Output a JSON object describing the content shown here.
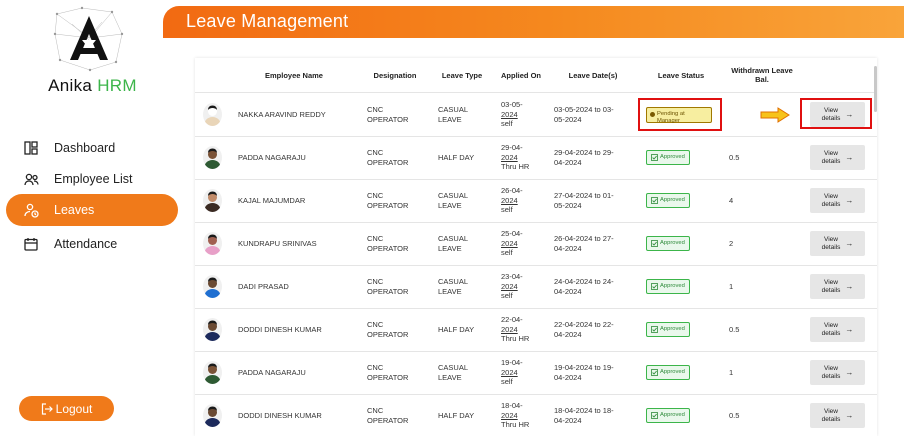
{
  "sidebar": {
    "brand_prefix": "Anika",
    "brand_highlight": "HRM",
    "items": [
      {
        "label": "Dashboard",
        "icon": "dashboard-icon",
        "active": false
      },
      {
        "label": "Employee List",
        "icon": "users-icon",
        "active": false
      },
      {
        "label": "Leaves",
        "icon": "leave-icon",
        "active": true
      },
      {
        "label": "Attendance",
        "icon": "calendar-icon",
        "active": false
      }
    ],
    "logout_label": "Logout"
  },
  "header": {
    "title": "Leave Management"
  },
  "table": {
    "columns": [
      "Employee Name",
      "Designation",
      "Leave Type",
      "Applied On",
      "Leave Date(s)",
      "Leave Status",
      "Withdrawn Leave Bal."
    ],
    "view_label_line1": "View",
    "view_label_line2": "details",
    "rows": [
      {
        "name": "NAKKA ARAVIND REDDY",
        "designation": [
          "CNC",
          "OPERATOR"
        ],
        "leave_type": [
          "CASUAL",
          "LEAVE"
        ],
        "applied_date": [
          "03-05-",
          "2024"
        ],
        "applied_by": "self",
        "leave_dates": [
          "03-05-2024 to 03-",
          "05-2024"
        ],
        "status": "Pending at Manager",
        "status_lines": [
          "Pending at",
          "Manager"
        ],
        "balance": ""
      },
      {
        "name": "PADDA NAGARAJU",
        "designation": [
          "CNC",
          "OPERATOR"
        ],
        "leave_type": [
          "HALF DAY",
          ""
        ],
        "applied_date": [
          "29-04-",
          "2024"
        ],
        "applied_by": "Thru HR",
        "leave_dates": [
          "29-04-2024 to 29-",
          "04-2024"
        ],
        "status": "Approved",
        "balance": "0.5"
      },
      {
        "name": "KAJAL MAJUMDAR",
        "designation": [
          "CNC",
          "OPERATOR"
        ],
        "leave_type": [
          "CASUAL",
          "LEAVE"
        ],
        "applied_date": [
          "26-04-",
          "2024"
        ],
        "applied_by": "self",
        "leave_dates": [
          "27-04-2024 to 01-",
          "05-2024"
        ],
        "status": "Approved",
        "balance": "4"
      },
      {
        "name": "KUNDRAPU SRINIVAS",
        "designation": [
          "CNC",
          "OPERATOR"
        ],
        "leave_type": [
          "CASUAL",
          "LEAVE"
        ],
        "applied_date": [
          "25-04-",
          "2024"
        ],
        "applied_by": "self",
        "leave_dates": [
          "26-04-2024 to 27-",
          "04-2024"
        ],
        "status": "Approved",
        "balance": "2"
      },
      {
        "name": "DADI PRASAD",
        "designation": [
          "CNC",
          "OPERATOR"
        ],
        "leave_type": [
          "CASUAL",
          "LEAVE"
        ],
        "applied_date": [
          "23-04-",
          "2024"
        ],
        "applied_by": "self",
        "leave_dates": [
          "24-04-2024 to 24-",
          "04-2024"
        ],
        "status": "Approved",
        "balance": "1"
      },
      {
        "name": "DODDI DINESH KUMAR",
        "designation": [
          "CNC",
          "OPERATOR"
        ],
        "leave_type": [
          "HALF DAY",
          ""
        ],
        "applied_date": [
          "22-04-",
          "2024"
        ],
        "applied_by": "Thru HR",
        "leave_dates": [
          "22-04-2024 to 22-",
          "04-2024"
        ],
        "status": "Approved",
        "balance": "0.5"
      },
      {
        "name": "PADDA NAGARAJU",
        "designation": [
          "CNC",
          "OPERATOR"
        ],
        "leave_type": [
          "CASUAL",
          "LEAVE"
        ],
        "applied_date": [
          "19-04-",
          "2024"
        ],
        "applied_by": "self",
        "leave_dates": [
          "19-04-2024 to 19-",
          "04-2024"
        ],
        "status": "Approved",
        "balance": "1"
      },
      {
        "name": "DODDI DINESH KUMAR",
        "designation": [
          "CNC",
          "OPERATOR"
        ],
        "leave_type": [
          "HALF DAY",
          ""
        ],
        "applied_date": [
          "18-04-",
          "2024"
        ],
        "applied_by": "Thru HR",
        "leave_dates": [
          "18-04-2024 to 18-",
          "04-2024"
        ],
        "status": "Approved",
        "balance": "0.5"
      }
    ]
  },
  "colors": {
    "accent": "#f07a1a",
    "brand_green": "#3cb54a",
    "approved_green": "#2e8b3a",
    "pending_yellow": "#f7eea0",
    "annotation_red": "#e01010"
  }
}
